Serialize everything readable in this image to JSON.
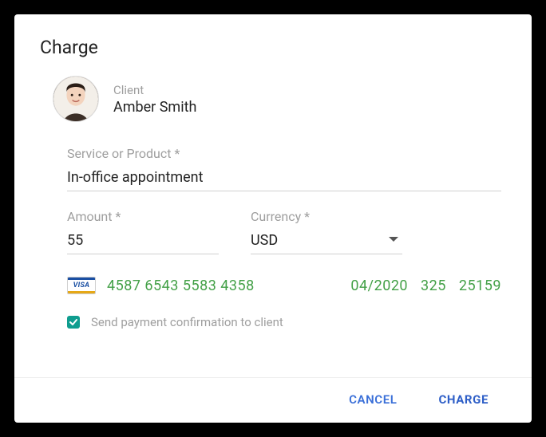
{
  "dialog": {
    "title": "Charge"
  },
  "client": {
    "label": "Client",
    "name": "Amber Smith"
  },
  "service": {
    "label": "Service or Product *",
    "value": "In-office appointment"
  },
  "amount": {
    "label": "Amount *",
    "value": "55"
  },
  "currency": {
    "label": "Currency *",
    "value": "USD"
  },
  "card": {
    "brand": "VISA",
    "number": "4587 6543 5583  4358",
    "expiry": "04/2020",
    "cvc": "325",
    "zip": "25159"
  },
  "confirmation": {
    "label": "Send payment confirmation to client",
    "checked": true
  },
  "actions": {
    "cancel": "CANCEL",
    "charge": "CHARGE"
  }
}
